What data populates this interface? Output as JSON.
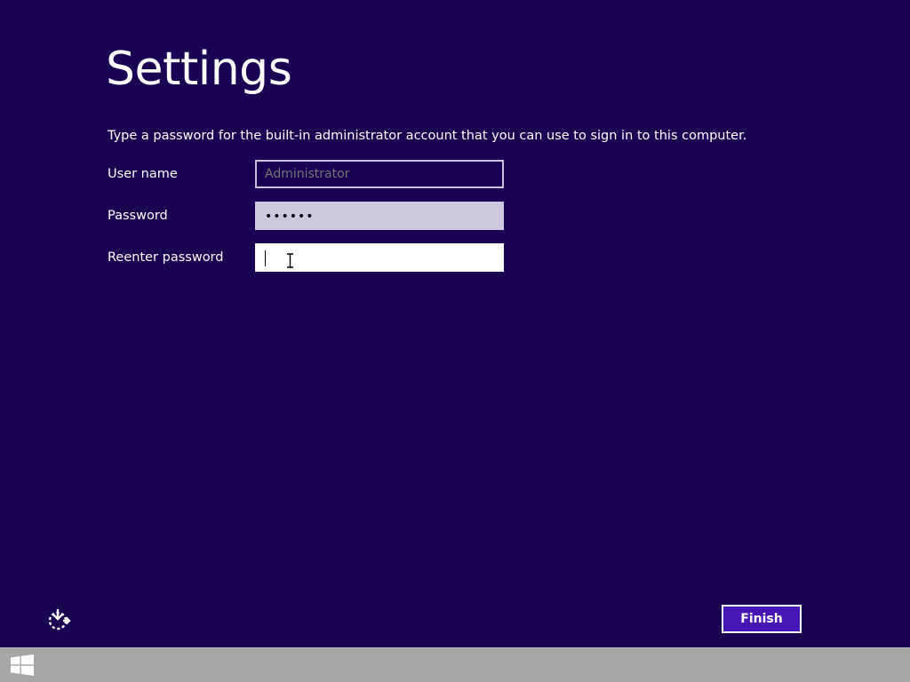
{
  "page": {
    "title": "Settings",
    "instruction": "Type a password for the built-in administrator account that you can use to sign in to this computer."
  },
  "form": {
    "username": {
      "label": "User name",
      "placeholder": "Administrator",
      "value": ""
    },
    "password": {
      "label": "Password",
      "value": "••••••"
    },
    "reenter_password": {
      "label": "Reenter password",
      "value": ""
    }
  },
  "footer": {
    "accessibility_icon": "ease-of-access-icon",
    "finish_label": "Finish"
  },
  "taskbar": {
    "start_icon": "windows-logo-icon"
  },
  "colors": {
    "background": "#180052",
    "button_accent": "#4617b4",
    "taskbar": "#a6a6a6"
  }
}
